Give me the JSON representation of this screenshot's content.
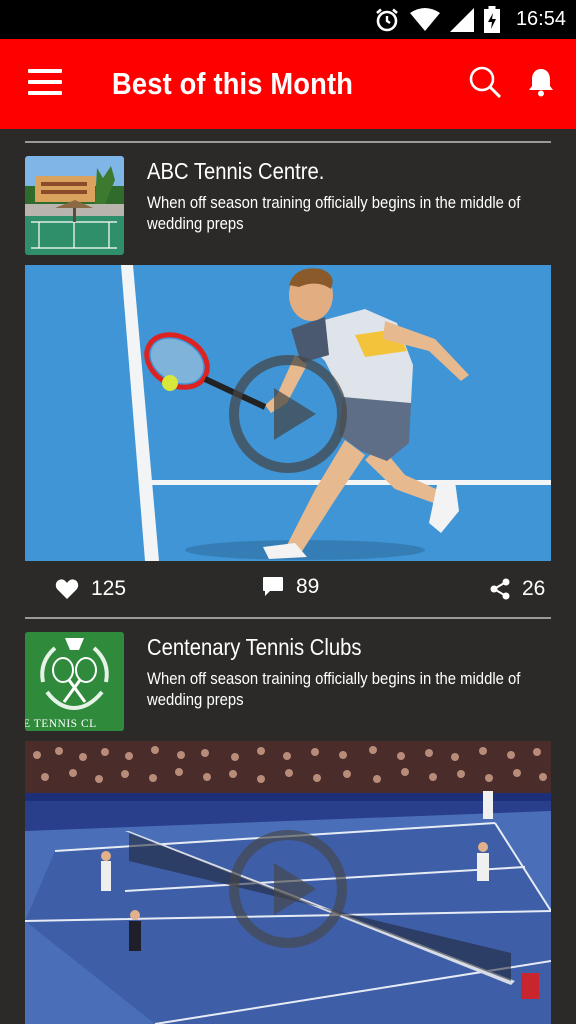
{
  "status_bar": {
    "time": "16:54",
    "icons": [
      "alarm-icon",
      "wifi-icon",
      "signal-icon",
      "battery-charging-icon"
    ]
  },
  "app_bar": {
    "title": "Best of this Month",
    "icons": [
      "menu-icon",
      "search-icon",
      "notification-bell-icon"
    ]
  },
  "feed": {
    "items": [
      {
        "title": "ABC Tennis Centre.",
        "description": "When off season training officially begins in the middle of wedding preps",
        "likes": "125",
        "comments": "89",
        "shares": "26"
      },
      {
        "title": "Centenary Tennis Clubs",
        "description": "When off season training officially begins in the middle of wedding preps",
        "logo_text": "E TENNIS CL"
      }
    ]
  },
  "colors": {
    "accent": "#ff0000",
    "background": "#2b2a28",
    "court_blue": "#3f95d6"
  }
}
